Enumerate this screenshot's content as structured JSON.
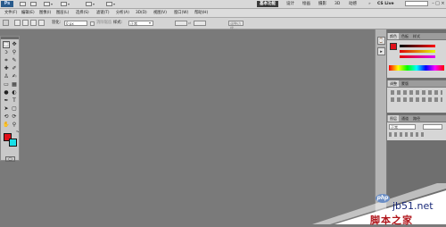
{
  "app": {
    "logo_text": "Ps",
    "workspaces": [
      "基本功能",
      "设计",
      "绘画",
      "摄影",
      "3D",
      "动感"
    ],
    "cs_live": "CS Live"
  },
  "menu": [
    "文件(F)",
    "编辑(E)",
    "图像(I)",
    "图层(L)",
    "选择(S)",
    "滤镜(T)",
    "分析(A)",
    "3D(D)",
    "视图(V)",
    "窗口(W)",
    "帮助(H)"
  ],
  "options": {
    "feather_label": "羽化:",
    "feather_value": "0 px",
    "antialias_label": "消除锯齿",
    "style_label": "样式:",
    "style_value": "正常",
    "refine_label": "调整边缘..."
  },
  "panels": {
    "color_tabs": [
      "颜色",
      "色板",
      "样式"
    ],
    "adjust_tabs": [
      "调整",
      "蒙版"
    ],
    "layers_tabs": [
      "图层",
      "通道",
      "路径"
    ],
    "blend_mode": "正常"
  },
  "colors": {
    "foreground": "#e0101a",
    "background": "#18e0e8"
  },
  "watermark": {
    "logo": "php",
    "site": "jb51.net",
    "name": "脚本之家"
  }
}
